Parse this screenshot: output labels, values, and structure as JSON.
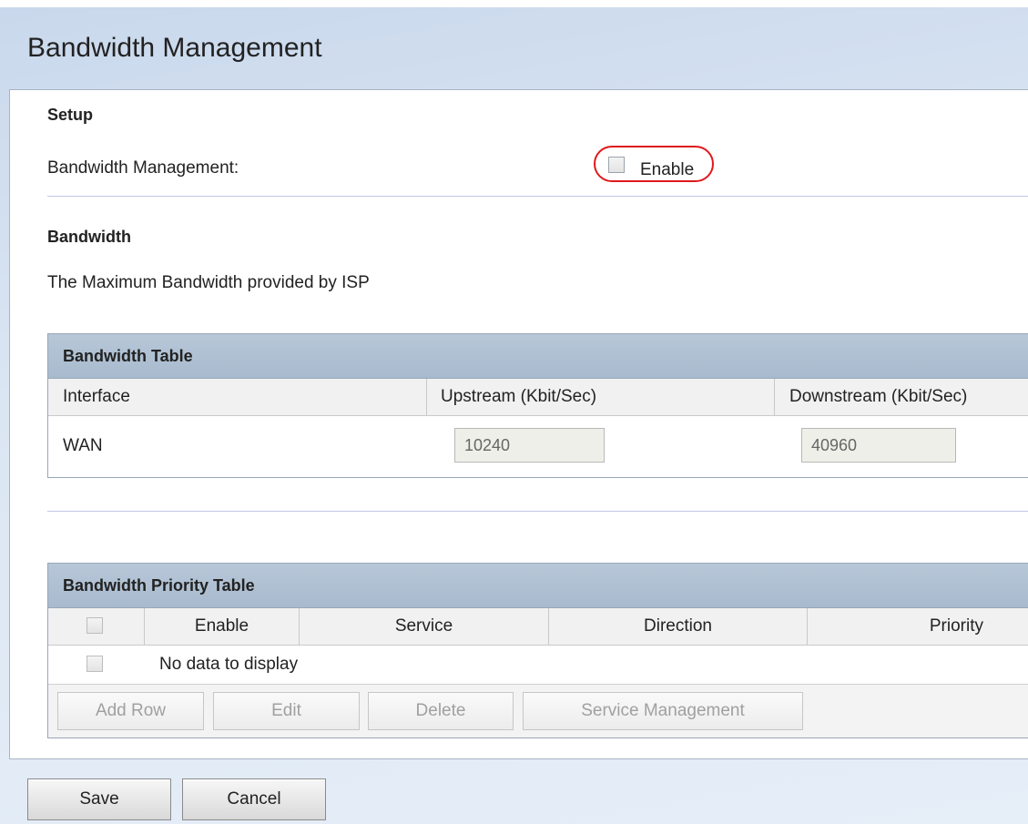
{
  "page": {
    "title": "Bandwidth Management"
  },
  "setup": {
    "heading": "Setup",
    "bw_mgmt_label": "Bandwidth Management:",
    "enable_label": "Enable"
  },
  "bandwidth": {
    "heading": "Bandwidth",
    "description": "The Maximum Bandwidth provided by ISP"
  },
  "bandwidth_table": {
    "title": "Bandwidth Table",
    "columns": [
      "Interface",
      "Upstream (Kbit/Sec)",
      "Downstream (Kbit/Sec)"
    ],
    "rows": [
      {
        "interface": "WAN",
        "upstream": "10240",
        "downstream": "40960"
      }
    ]
  },
  "priority_table": {
    "title": "Bandwidth Priority Table",
    "columns": [
      "Enable",
      "Service",
      "Direction",
      "Priority"
    ],
    "empty_text": "No data to display",
    "buttons": {
      "add_row": "Add Row",
      "edit": "Edit",
      "delete": "Delete",
      "service_management": "Service Management"
    }
  },
  "footer": {
    "save": "Save",
    "cancel": "Cancel"
  },
  "colors": {
    "highlight": "#e0191c",
    "table_header": "#b0c1d4"
  }
}
